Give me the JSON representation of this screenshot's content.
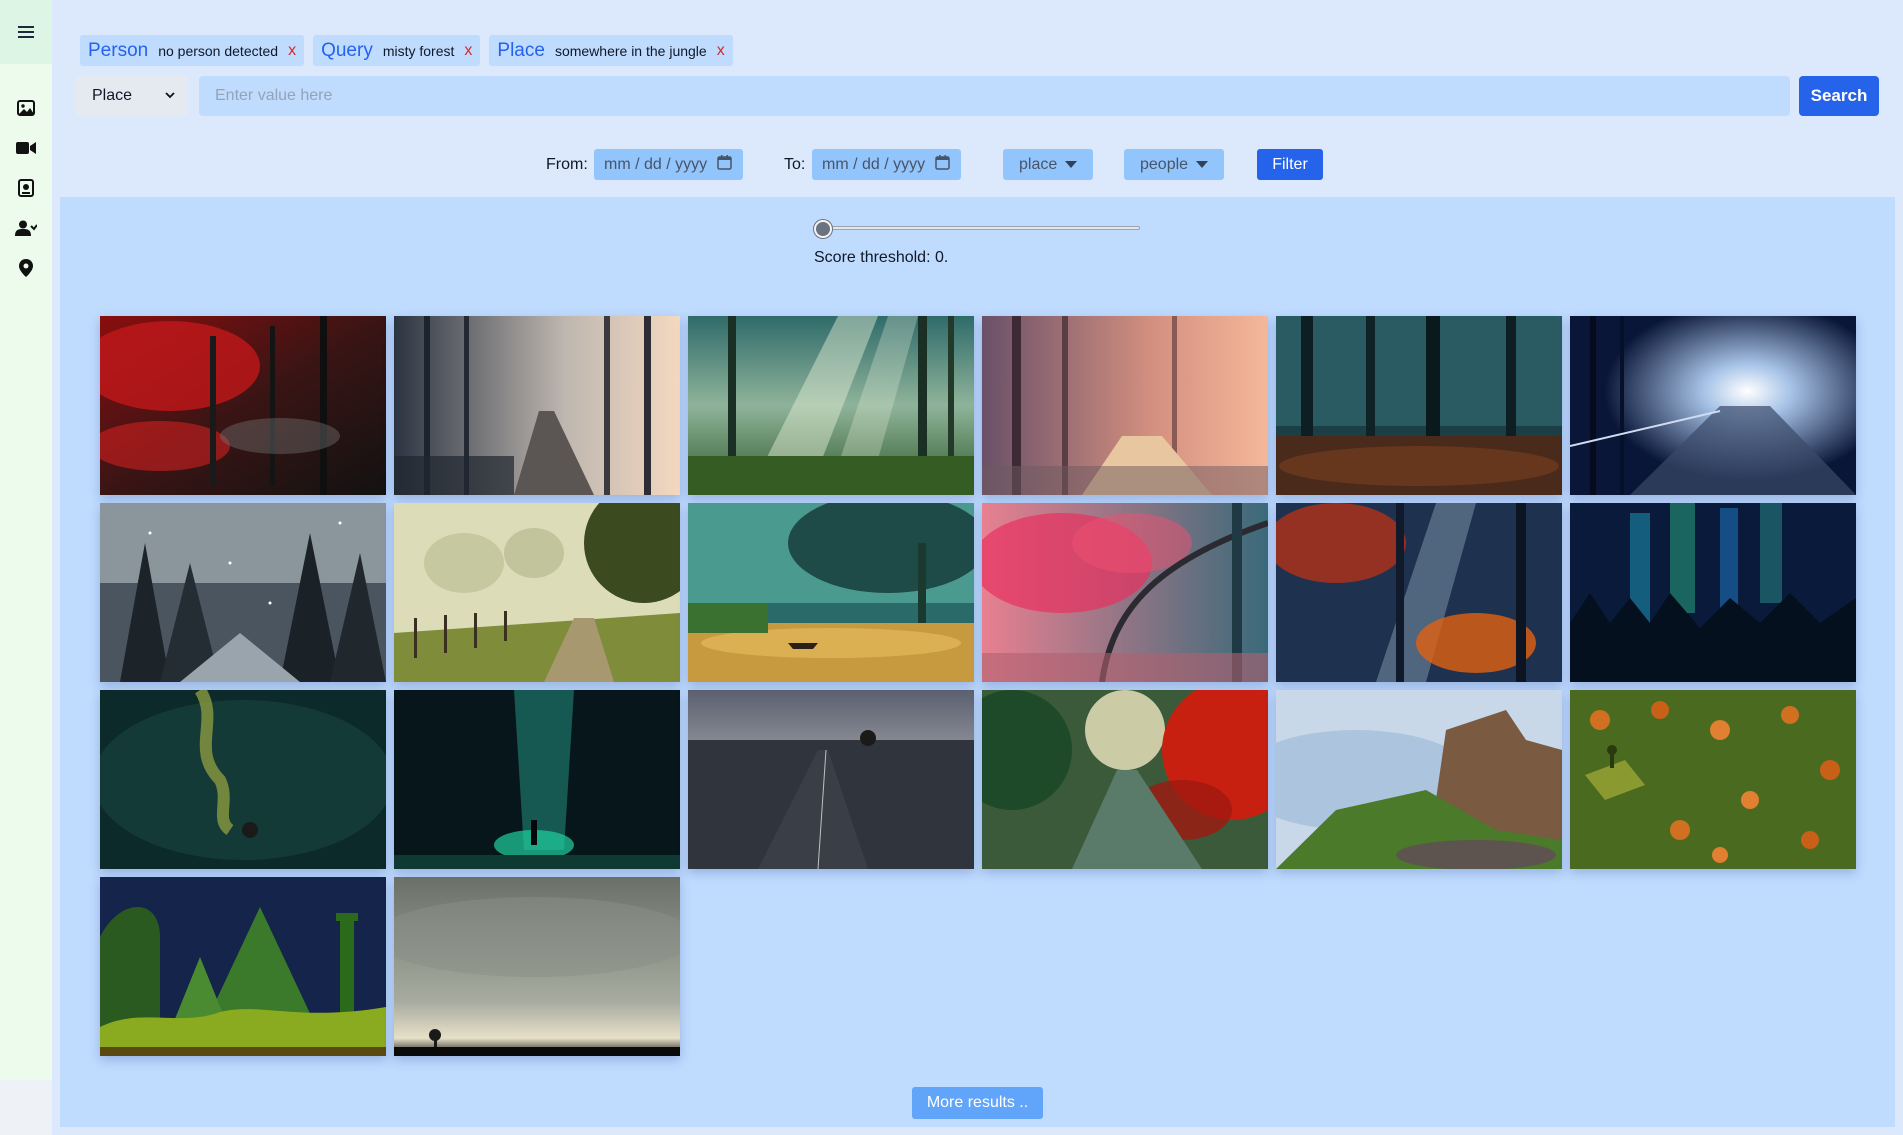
{
  "sidebar": {
    "menu_icon": "hamburger-menu-icon",
    "items": [
      {
        "icon": "image-icon"
      },
      {
        "icon": "video-camera-icon"
      },
      {
        "icon": "photo-album-icon"
      },
      {
        "icon": "person-icon"
      },
      {
        "icon": "location-pin-icon"
      }
    ]
  },
  "chips": [
    {
      "key": "Person",
      "value": "no person detected",
      "remove": "x"
    },
    {
      "key": "Query",
      "value": "misty forest",
      "remove": "x"
    },
    {
      "key": "Place",
      "value": "somewhere in the jungle",
      "remove": "x"
    }
  ],
  "search": {
    "type_selected": "Place",
    "placeholder": "Enter value here",
    "button": "Search"
  },
  "filters": {
    "from_label": "From:",
    "to_label": "To:",
    "date_placeholder": "mm / dd / yyyy",
    "place_dropdown": "place",
    "people_dropdown": "people",
    "filter_button": "Filter"
  },
  "threshold": {
    "label": "Score threshold: 0.",
    "value": 0
  },
  "results": [
    {
      "name": "red-autumn-forest"
    },
    {
      "name": "misty-forest-road"
    },
    {
      "name": "sunbeams-green-forest"
    },
    {
      "name": "pink-misty-forest-path"
    },
    {
      "name": "dark-teal-forest"
    },
    {
      "name": "glowing-light-forest-path"
    },
    {
      "name": "snowy-pine-forest"
    },
    {
      "name": "foggy-meadow-fence"
    },
    {
      "name": "jungle-lake-boat"
    },
    {
      "name": "pink-blossom-tree"
    },
    {
      "name": "sunlit-autumn-forest"
    },
    {
      "name": "aurora-pine-forest"
    },
    {
      "name": "dark-underwater-scene"
    },
    {
      "name": "green-light-beam-figure"
    },
    {
      "name": "empty-road-dusk"
    },
    {
      "name": "red-trees-road"
    },
    {
      "name": "misty-cliff-mountain"
    },
    {
      "name": "green-joystick-pattern"
    },
    {
      "name": "game-hills-landscape"
    },
    {
      "name": "foggy-plain-lone-tree"
    }
  ],
  "more_button": "More results .."
}
